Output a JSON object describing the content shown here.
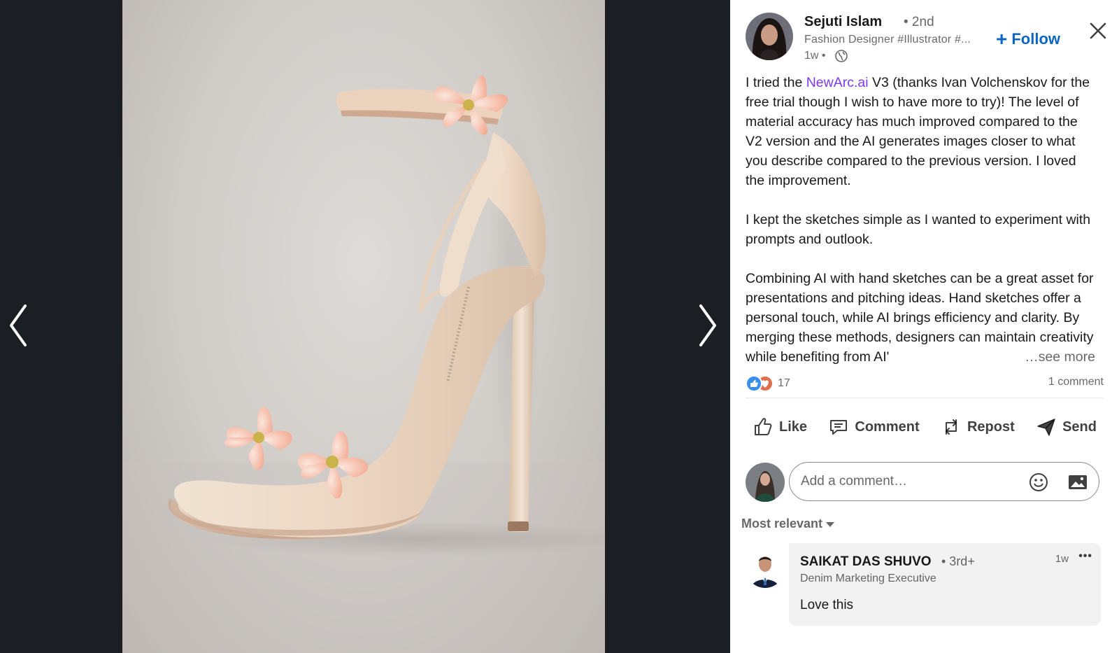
{
  "viewer": {
    "prev_arrow": "chevron-left-icon",
    "next_arrow": "chevron-right-icon",
    "image_subject": "cream high-heel sandal with peach lily flowers"
  },
  "post": {
    "author": {
      "name": "Sejuti Islam",
      "degree": "• 2nd",
      "headline": "Fashion Designer #Illustrator #...",
      "time": "1w •"
    },
    "follow_label": "Follow",
    "body": {
      "p1_prefix": "I tried the ",
      "p1_mention": "NewArc.ai",
      "p1_suffix": " V3 (thanks Ivan Volchenskov for the free trial though I wish to have more to try)! The level of material accuracy has much improved compared to the V2 version and the AI generates images closer to what you describe compared to the previous version. I loved the improvement.",
      "p2": "I kept the sketches simple as I wanted to experiment with prompts and outlook.",
      "p3": "Combining AI with hand sketches can be a great asset for presentations and pitching ideas. Hand sketches offer a personal touch, while AI brings efficiency and clarity. By merging these methods, designers can maintain creativity while benefiting from AI'",
      "see_more": "…see more"
    },
    "reaction_count": "17",
    "comment_count": "1 comment",
    "actions": {
      "like": "Like",
      "comment": "Comment",
      "repost": "Repost",
      "send": "Send"
    },
    "comment_input_placeholder": "Add a comment…",
    "sort_label": "Most relevant",
    "comments": [
      {
        "name": "SAIKAT DAS SHUVO",
        "degree": "• 3rd+",
        "headline": "Denim Marketing Executive",
        "time": "1w",
        "menu": "•••",
        "text": "Love this"
      }
    ]
  },
  "colors": {
    "viewer_bg": "#1b1f23",
    "link_blue": "#0a66c2",
    "mention_purple": "#7c3aed",
    "like_blue": "#378fe9",
    "love_red": "#df704d"
  }
}
